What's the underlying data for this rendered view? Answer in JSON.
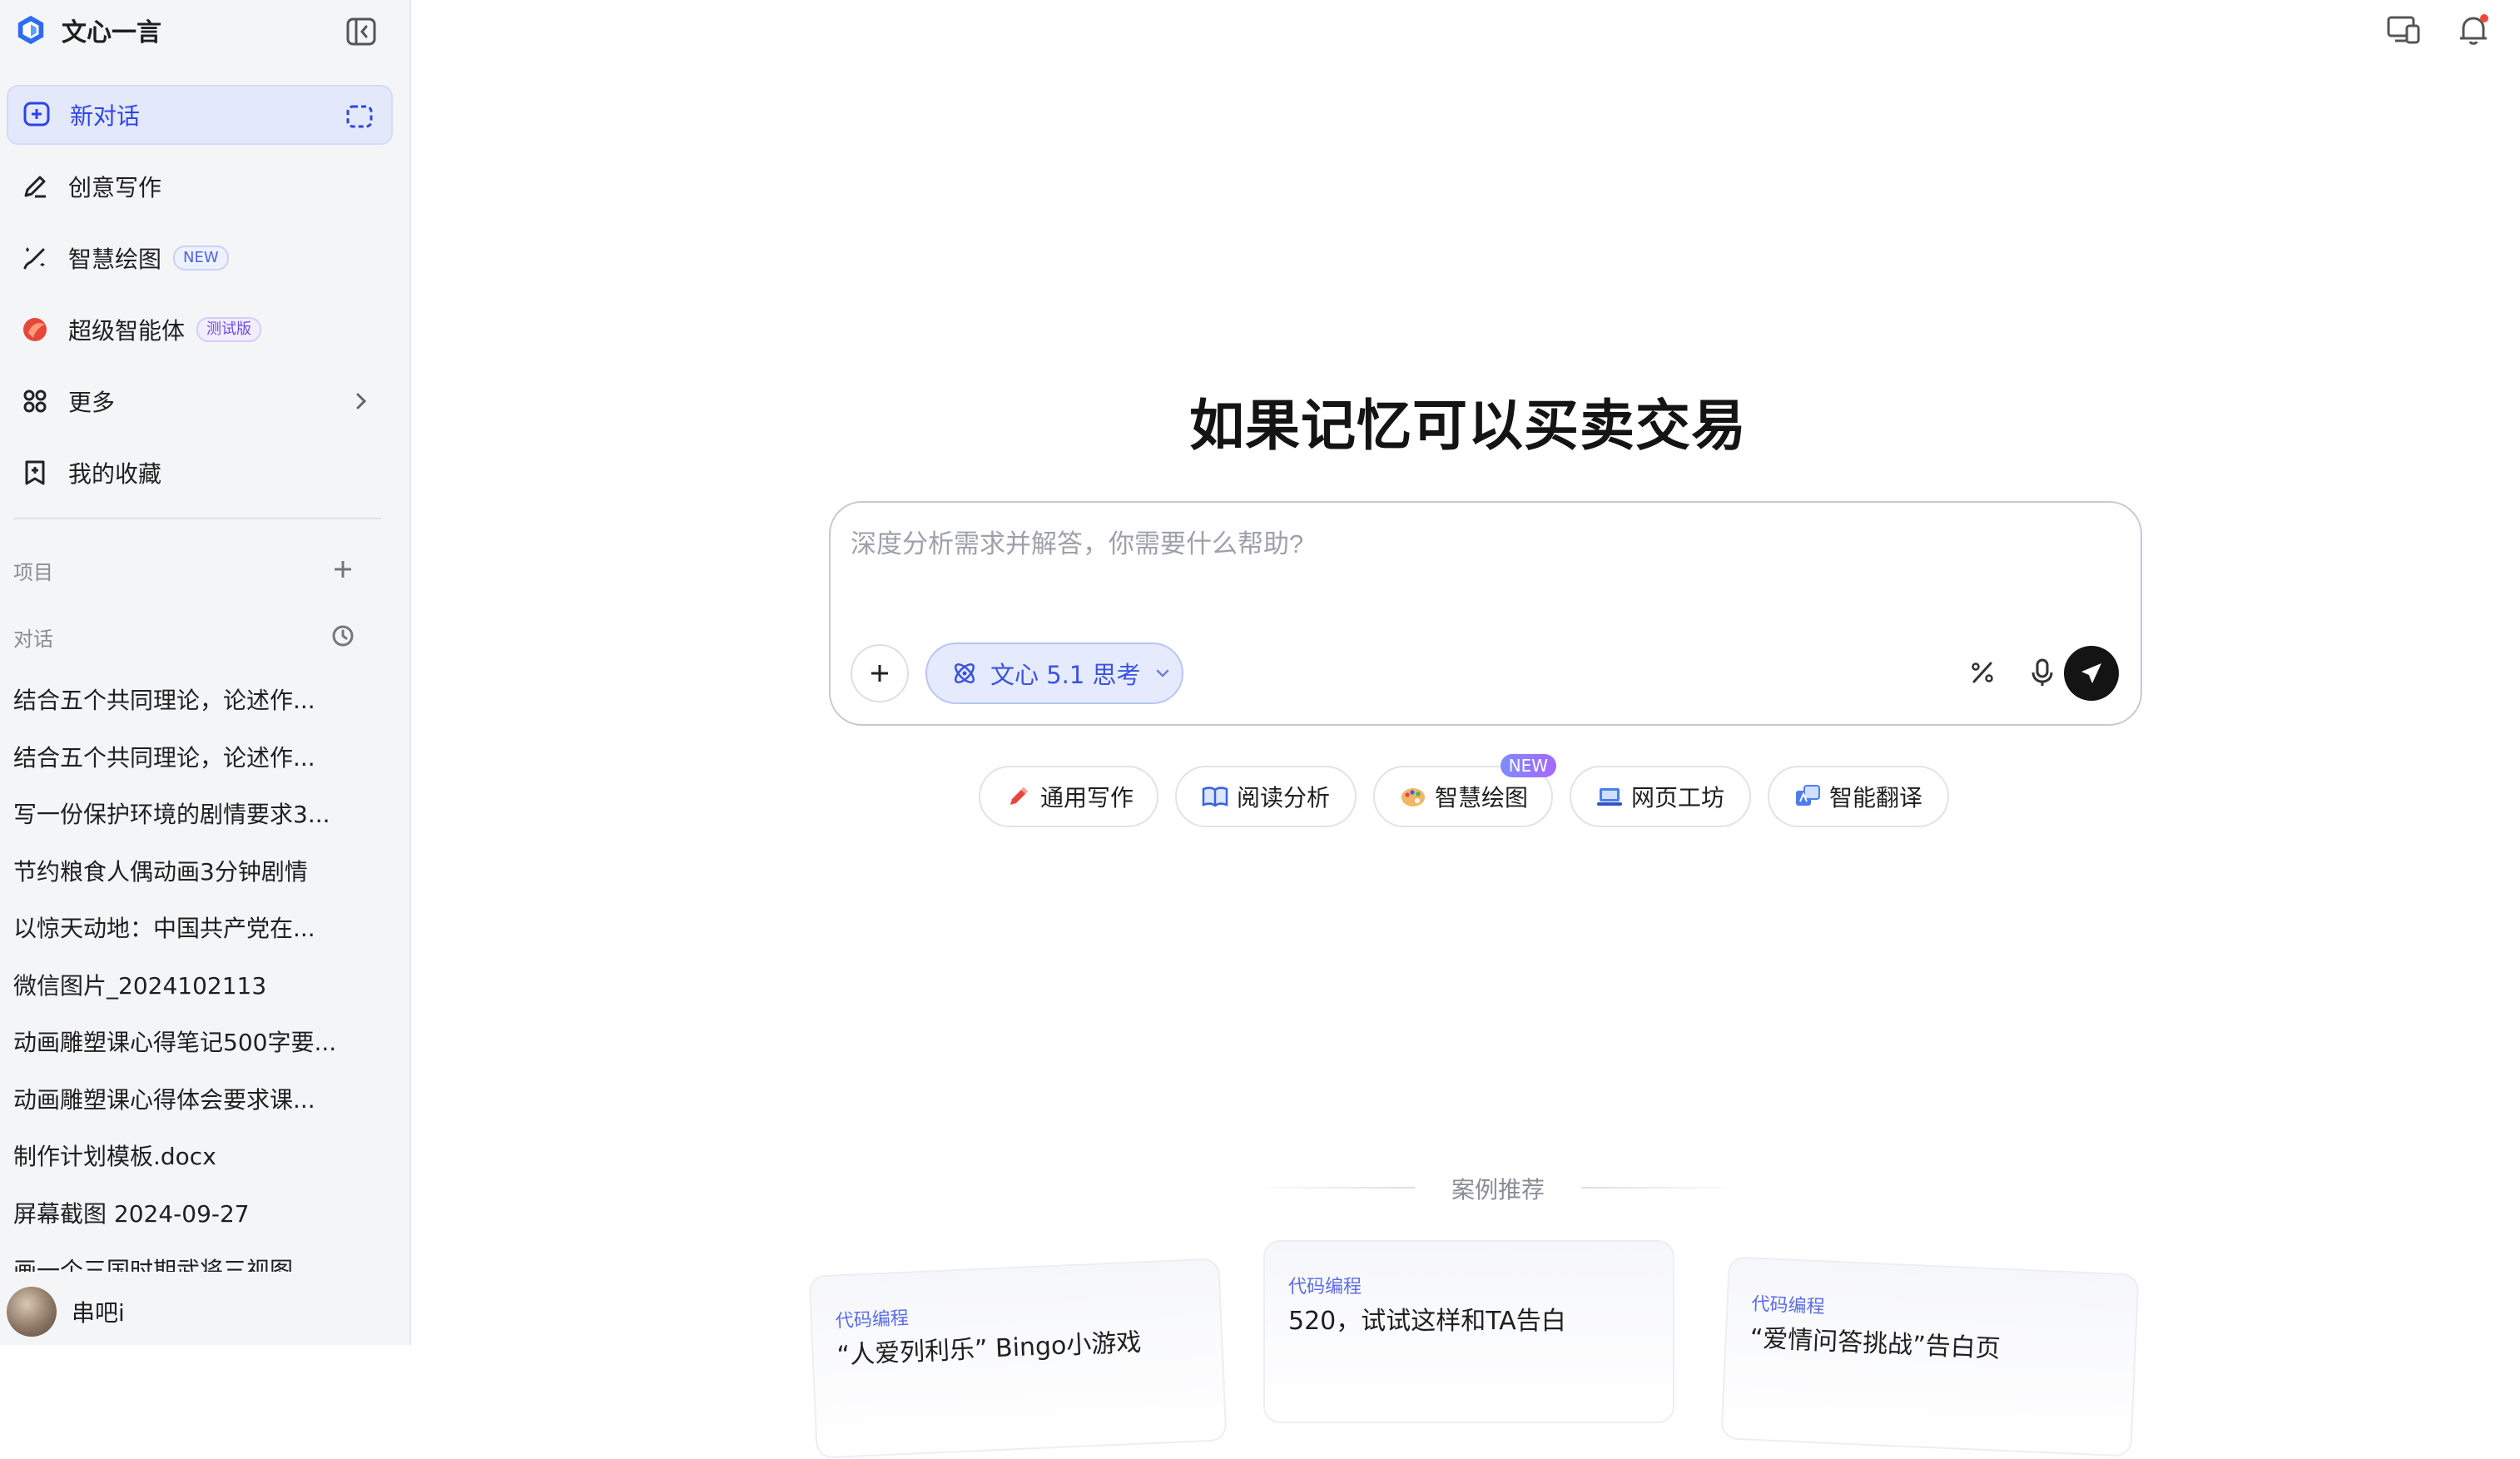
{
  "app": {
    "name": "文心一言"
  },
  "sidebar": {
    "nav": [
      {
        "label": "新对话"
      },
      {
        "label": "创意写作"
      },
      {
        "label": "智慧绘图",
        "badge": "NEW"
      },
      {
        "label": "超级智能体",
        "badge": "测试版"
      },
      {
        "label": "更多"
      },
      {
        "label": "我的收藏"
      }
    ],
    "sections": {
      "projects": "项目",
      "conversations": "对话"
    },
    "conversations": [
      "结合五个共同理论，论述作...",
      "结合五个共同理论，论述作...",
      "写一份保护环境的剧情要求3...",
      "节约粮食人偶动画3分钟剧情",
      "以惊天动地：中国共产党在...",
      "微信图片_2024102113",
      "动画雕塑课心得笔记500字要...",
      "动画雕塑课心得体会要求课...",
      "制作计划模板.docx",
      "屏幕截图 2024-09-27",
      "画一个三国时期武将三视图"
    ],
    "user": {
      "name": "串吧i"
    }
  },
  "main": {
    "title": "如果记忆可以买卖交易",
    "composer": {
      "placeholder": "深度分析需求并解答，你需要什么帮助?",
      "model_label": "文心 5.1 思考"
    },
    "chips": [
      {
        "label": "通用写作"
      },
      {
        "label": "阅读分析"
      },
      {
        "label": "智慧绘图",
        "tag": "NEW"
      },
      {
        "label": "网页工坊"
      },
      {
        "label": "智能翻译"
      }
    ],
    "cases_title": "案例推荐",
    "cases": [
      {
        "tag": "代码编程",
        "title": "“人爱列利乐” Bingo小游戏"
      },
      {
        "tag": "代码编程",
        "title": "520，试试这样和TA告白"
      },
      {
        "tag": "代码编程",
        "title": "“爱情问答挑战”告白页"
      }
    ]
  },
  "colors": {
    "accent": "#2c45e8",
    "sidebar_bg": "#f4f5f7",
    "send_bg": "#141414"
  }
}
